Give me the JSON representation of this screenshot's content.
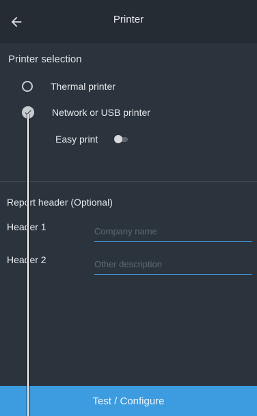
{
  "header": {
    "title": "Printer",
    "back_icon": "arrow-left-icon"
  },
  "printer_selection": {
    "title": "Printer selection",
    "options": [
      {
        "label": "Thermal printer",
        "selected": false
      },
      {
        "label": "Network or USB printer",
        "selected": true
      }
    ],
    "easy_print": {
      "label": "Easy print",
      "enabled": false
    }
  },
  "report_header": {
    "title": "Report header (Optional)",
    "fields": [
      {
        "label": "Header 1",
        "value": "",
        "placeholder": "Company name"
      },
      {
        "label": "Header 2",
        "value": "",
        "placeholder": "Other description"
      }
    ]
  },
  "footer": {
    "button_label": "Test / Configure"
  },
  "colors": {
    "background": "#2b343c",
    "topbar": "#252c33",
    "accent": "#3d9be0",
    "input_underline": "#3d8fd1"
  }
}
